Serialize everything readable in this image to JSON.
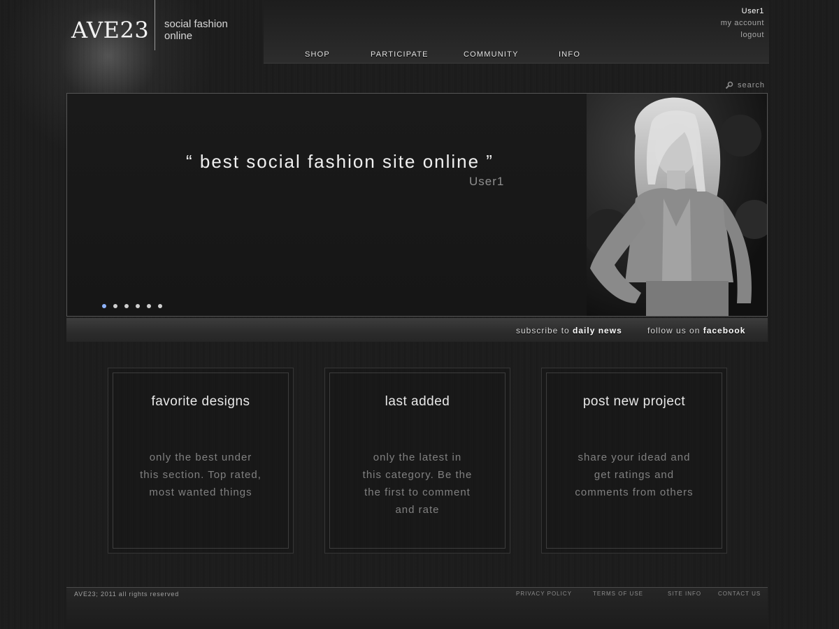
{
  "brand": {
    "logo": "AVE23",
    "tagline_line1": "social fashion",
    "tagline_line2": "online"
  },
  "user": {
    "name": "User1",
    "account_label": "my account",
    "logout_label": "logout"
  },
  "nav": {
    "items": [
      {
        "label": "SHOP"
      },
      {
        "label": "PARTICIPATE"
      },
      {
        "label": "COMMUNITY"
      },
      {
        "label": "INFO"
      }
    ]
  },
  "search": {
    "label": "search",
    "icon": "search-icon"
  },
  "hero": {
    "quote": "“ best social fashion site online ”",
    "author": "User1",
    "slide_count": 6,
    "active_slide": 1,
    "photo": "woman-portrait-photo"
  },
  "subscribe_bar": {
    "subscribe_prefix": "subscribe to ",
    "subscribe_bold": "daily news",
    "follow_prefix": "follow us on ",
    "follow_bold": "facebook"
  },
  "features": [
    {
      "title": "favorite designs",
      "lines": [
        "only the best under",
        "this section. Top rated,",
        "most wanted things"
      ]
    },
    {
      "title": "last added",
      "lines": [
        "only the latest in",
        "this category. Be the",
        "the first to comment",
        "and rate"
      ]
    },
    {
      "title": "post new project",
      "lines": [
        "share your idead and",
        "get ratings and",
        "comments from others"
      ]
    }
  ],
  "footer": {
    "copyright": "AVE23; 2011 all rights reserved",
    "links": [
      {
        "label": "PRIVACY POLICY"
      },
      {
        "label": "TERMS OF USE"
      },
      {
        "label": "SITE INFO"
      },
      {
        "label": "CONTACT US"
      }
    ]
  },
  "colors": {
    "background": "#1c1c1c",
    "active_dot": "#8fb4ff",
    "text_light": "#f0f0f0",
    "text_muted": "#808080"
  }
}
